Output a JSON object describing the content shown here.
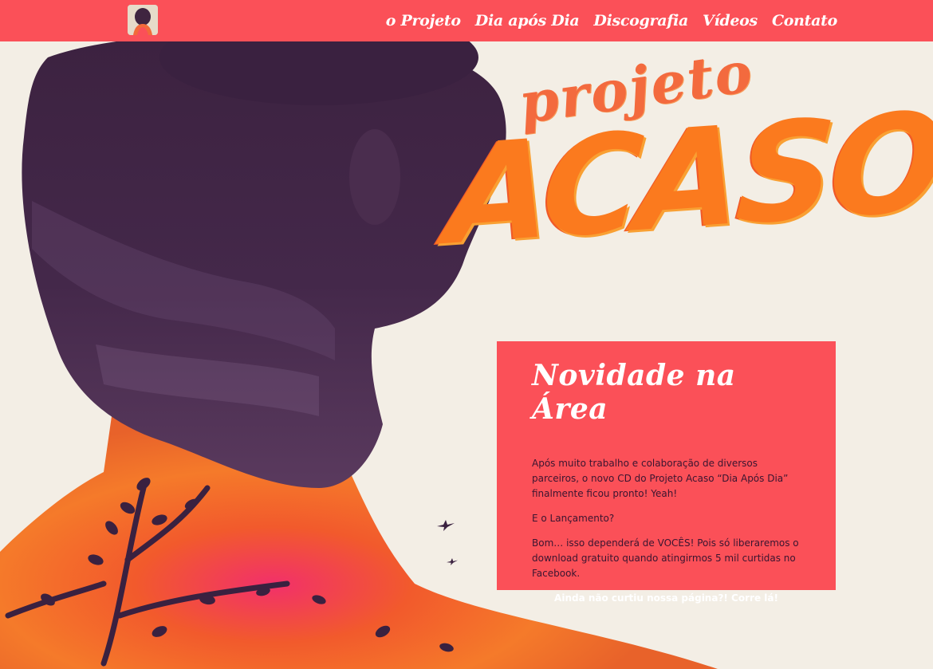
{
  "header": {
    "nav": [
      "o Projeto",
      "Dia após Dia",
      "Discografia",
      "Vídeos",
      "Contato"
    ]
  },
  "brand": {
    "small": "projeto",
    "big": "ACASO"
  },
  "news": {
    "title": "Novidade na Área",
    "paragraph1": "Após muito trabalho e colaboração de diversos parceiros, o novo CD do Projeto Acaso “Dia Após Dia” finalmente ficou pronto! Yeah!",
    "paragraph2": "E o Lançamento?",
    "paragraph3": "Bom… isso dependerá de VOCÊS! Pois só liberaremos o download gratuito quando atingirmos 5 mil curtidas no Facebook.",
    "cta": "Ainda não curtiu nossa página?! Corre lá!"
  },
  "colors": {
    "accent": "#fb5058",
    "background": "#f3eee5",
    "title_orange": "#fb7a1e",
    "silhouette": "#3f2540"
  },
  "icons": {
    "logo": "profile-avatar-icon",
    "birds": "bird-icon"
  }
}
